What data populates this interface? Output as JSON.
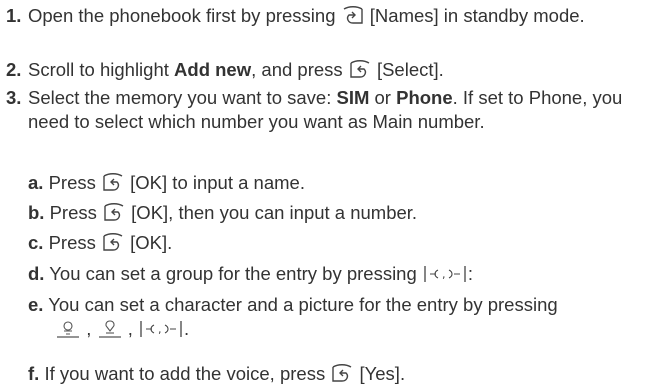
{
  "steps": [
    {
      "number": "1.",
      "text_before": "Open the phonebook first by pressing",
      "icon": "right-soft-key-icon",
      "text_after": "[Names] in standby mode."
    },
    {
      "number": "2.",
      "text_before": "Scroll to highlight",
      "bold": "Add new",
      "text_middle": ", and press",
      "icon": "left-soft-key-icon",
      "text_after": "[Select]."
    },
    {
      "number": "3.",
      "text_before": "Select the memory you want to save:",
      "bold1": "SIM",
      "text_or": "or",
      "bold2": "Phone",
      "text_after": ". If set to Phone, you need to select which number you want as Main number."
    }
  ],
  "substeps": [
    {
      "letter": "a.",
      "text_before": "Press",
      "icon": "left-soft-key-icon",
      "text_after": "[OK] to input a name."
    },
    {
      "letter": "b.",
      "text_before": "Press",
      "icon": "left-soft-key-icon",
      "text_after": "[OK], then you can input a number."
    },
    {
      "letter": "c.",
      "text_before": "Press",
      "icon": "left-soft-key-icon",
      "text_after": "[OK]."
    },
    {
      "letter": "d.",
      "text_before": "You can set a group for the entry by pressing",
      "icon": "left-right-navigation-key-icon",
      "text_after": ":"
    },
    {
      "letter": "e.",
      "text_before": "You can set a character and a picture for the entry by pressing",
      "icons": [
        "up-navigation-key-icon",
        "down-navigation-key-icon",
        "left-right-navigation-key-icon"
      ],
      "separator": ",",
      "text_after": "."
    },
    {
      "letter": "f.",
      "text_before": "If you want to add the voice, press",
      "icon": "left-soft-key-icon",
      "text_after": "[Yes]."
    }
  ]
}
